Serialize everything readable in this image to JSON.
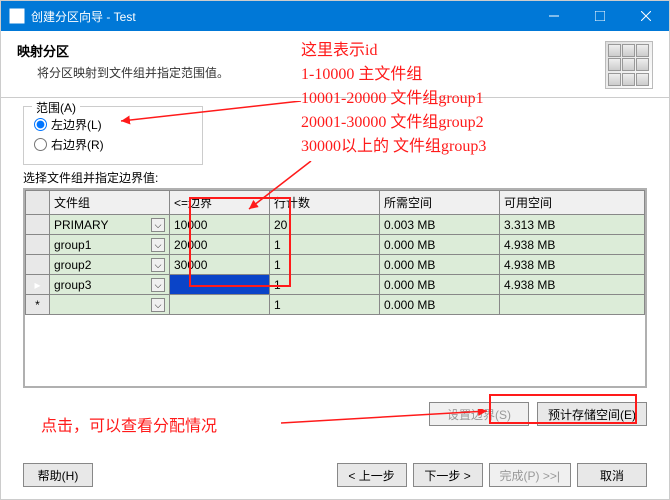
{
  "titlebar": {
    "title": "创建分区向导 - Test"
  },
  "header": {
    "title": "映射分区",
    "sub": "将分区映射到文件组并指定范围值。"
  },
  "range": {
    "legend": "范围(A)",
    "left": "左边界(L)",
    "right": "右边界(R)"
  },
  "grid_label": "选择文件组并指定边界值:",
  "columns": {
    "filegroup": "文件组",
    "boundary": "<=边界",
    "rowcount": "行计数",
    "reqspace": "所需空间",
    "availspace": "可用空间"
  },
  "rows": [
    {
      "fg": "PRIMARY",
      "b": "10000",
      "rc": "20",
      "req": "0.003 MB",
      "av": "3.313 MB"
    },
    {
      "fg": "group1",
      "b": "20000",
      "rc": "1",
      "req": "0.000 MB",
      "av": "4.938 MB"
    },
    {
      "fg": "group2",
      "b": "30000",
      "rc": "1",
      "req": "0.000 MB",
      "av": "4.938 MB"
    },
    {
      "fg": "group3",
      "b": "",
      "rc": "1",
      "req": "0.000 MB",
      "av": "4.938 MB"
    },
    {
      "fg": "",
      "b": "",
      "rc": "1",
      "req": "0.000 MB",
      "av": ""
    }
  ],
  "buttons": {
    "set_bound": "设置边界(S)",
    "est_space": "预计存储空间(E)",
    "help": "帮助(H)",
    "prev": "< 上一步",
    "next": "下一步 >",
    "finish": "完成(P) >>|",
    "cancel": "取消"
  },
  "annotations": {
    "top1": "这里表示id",
    "top2": "1-10000 主文件组",
    "top3": "10001-20000 文件组group1",
    "top4": "20001-30000 文件组group2",
    "top5": "30000以上的 文件组group3",
    "bottom": "点击，可以查看分配情况"
  }
}
